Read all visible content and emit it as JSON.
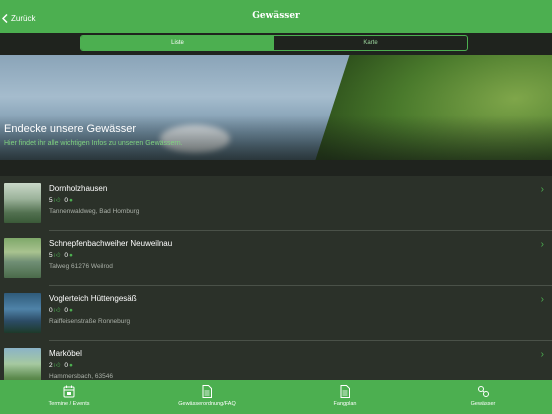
{
  "header": {
    "back_label": "Zurück",
    "title": "Gewässer"
  },
  "segments": {
    "active": "Liste",
    "inactive": "Karte"
  },
  "hero": {
    "title": "Endecke unsere Gewässer",
    "subtitle": "Hier findet ihr alle wichtigen Infos zu unseren Gewässern."
  },
  "list": [
    {
      "name": "Dornholzhausen",
      "likes": "5",
      "comments": "0",
      "address": "Tannenwaldweg, Bad Homburg"
    },
    {
      "name": "Schnepfenbachweiher Neuweilnau",
      "likes": "5",
      "comments": "0",
      "address": "Talweg 61276 Weilrod"
    },
    {
      "name": "Voglerteich Hüttengesäß",
      "likes": "0",
      "comments": "0",
      "address": "Raiffeisenstraße Ronneburg"
    },
    {
      "name": "Marköbel",
      "likes": "2",
      "comments": "0",
      "address": "Hammersbach, 63546"
    }
  ],
  "tabs": [
    {
      "label": "Termine / Events",
      "icon": "calendar-icon"
    },
    {
      "label": "Gewässerordnung/FAQ",
      "icon": "document-icon"
    },
    {
      "label": "Fangplan",
      "icon": "document-icon"
    },
    {
      "label": "Gewässer",
      "icon": "fish-icon"
    }
  ],
  "colors": {
    "accent": "#4caf50",
    "background": "#252a24",
    "list_bg": "#2b3129"
  }
}
